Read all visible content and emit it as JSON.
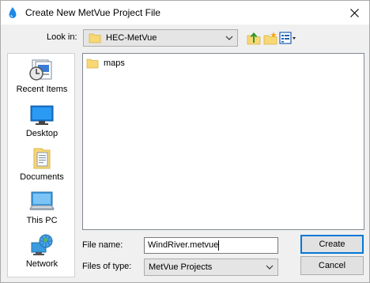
{
  "window": {
    "title": "Create New MetVue Project File"
  },
  "look_in": {
    "label": "Look in:",
    "value": "HEC-MetVue"
  },
  "toolbar": {
    "icons": [
      "up-one-level-icon",
      "create-new-folder-icon",
      "view-menu-icon"
    ]
  },
  "places": [
    {
      "label": "Recent Items",
      "icon": "recent-items-icon"
    },
    {
      "label": "Desktop",
      "icon": "desktop-icon"
    },
    {
      "label": "Documents",
      "icon": "documents-icon"
    },
    {
      "label": "This PC",
      "icon": "this-pc-icon"
    },
    {
      "label": "Network",
      "icon": "network-icon"
    }
  ],
  "files": [
    {
      "name": "maps",
      "icon": "folder-icon"
    }
  ],
  "file_name": {
    "label": "File name:",
    "value": "WindRiver.metvue"
  },
  "files_of_type": {
    "label": "Files of type:",
    "value": "MetVue Projects"
  },
  "buttons": {
    "create": "Create",
    "cancel": "Cancel"
  },
  "colors": {
    "accent": "#0078d7",
    "folder": "#f8d775",
    "window_bg": "#f0f0f0"
  }
}
